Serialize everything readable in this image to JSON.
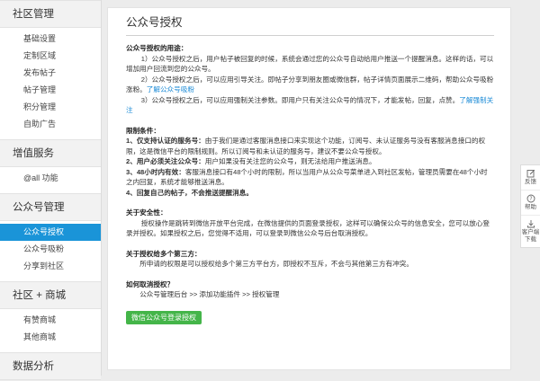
{
  "sidebar": {
    "sections": [
      {
        "title": "社区管理",
        "items": [
          "基础设置",
          "定制区域",
          "发布帖子",
          "帖子管理",
          "积分管理",
          "自助广告"
        ]
      },
      {
        "title": "增值服务",
        "items": [
          "@all 功能"
        ]
      },
      {
        "title": "公众号管理",
        "items": [
          "公众号授权",
          "公众号吸粉",
          "分享到社区"
        ],
        "active_index": 0
      },
      {
        "title": "社区 + 商城",
        "items": [
          "有赞商城",
          "其他商城"
        ]
      },
      {
        "title": "数据分析",
        "items": []
      }
    ]
  },
  "main": {
    "title": "公众号授权",
    "purpose_heading": "公众号授权的用途：",
    "purpose_1": "1）公众号授权之后，用户帖子被回复的时候，系统会通过您的公众号自动给用户推送一个提醒消息。这样的话，可以增加用户回流到您的公众号。",
    "purpose_2": "2）公众号授权之后，可以应用引导关注。即帖子分享到朋友圈或微信群，帖子详情页面展示二维码，帮助公众号吸粉涨粉。",
    "purpose_2_link": "了解公众号吸粉",
    "purpose_3": "3）公众号授权之后，可以应用强制关注参数。即用户只有关注公众号的情况下，才能发帖，回复，点赞。",
    "purpose_3_link": "了解强制关注",
    "limits_heading": "限制条件：",
    "limit_1_bold": "1、仅支持认证的服务号：",
    "limit_1_text": "由于我们是通过客服消息接口来实现这个功能，订阅号、未认证服务号没有客服消息接口的权限，这是微信平台的限制规则。所以订阅号和未认证的服务号，建议不要公众号授权。",
    "limit_2_bold": "2、用户必须关注公众号：",
    "limit_2_text": "用户如果没有关注您的公众号，则无法给用户推送消息。",
    "limit_3_bold": "3、48小时内有效：",
    "limit_3_text": "客服消息接口有48个小时的限制，所以当用户从公众号菜单进入到社区发帖，管理员需要在48个小时之内回复，系统才能够推送消息。",
    "limit_4_bold": "4、回复自己的帖子，不会推送提醒消息。",
    "security_heading": "关于安全性：",
    "security_text": "授权操作是跳转到微信开放平台完成，在微信提供的页面登录授权，这样可以确保公众号的信息安全，您可以放心登录并授权。如果授权之后，您觉得不适用，可以登录到微信公众号后台取消授权。",
    "third_heading": "关于授权给多个第三方：",
    "third_text": "所申请的权限是可以授权给多个第三方平台方，即授权不互斥，不会与其他第三方有冲突。",
    "cancel_heading": "如何取消授权？",
    "cancel_path": "公众号管理后台 >> 添加功能插件 >> 授权管理",
    "login_button": "微信公众号登录授权"
  },
  "float_bar": {
    "feedback": "反馈",
    "help": "帮助",
    "download_line1": "客户端",
    "download_line2": "下载"
  },
  "colors": {
    "accent": "#1a94d8",
    "login_button": "#44b549",
    "link": "#1a8ad6"
  }
}
